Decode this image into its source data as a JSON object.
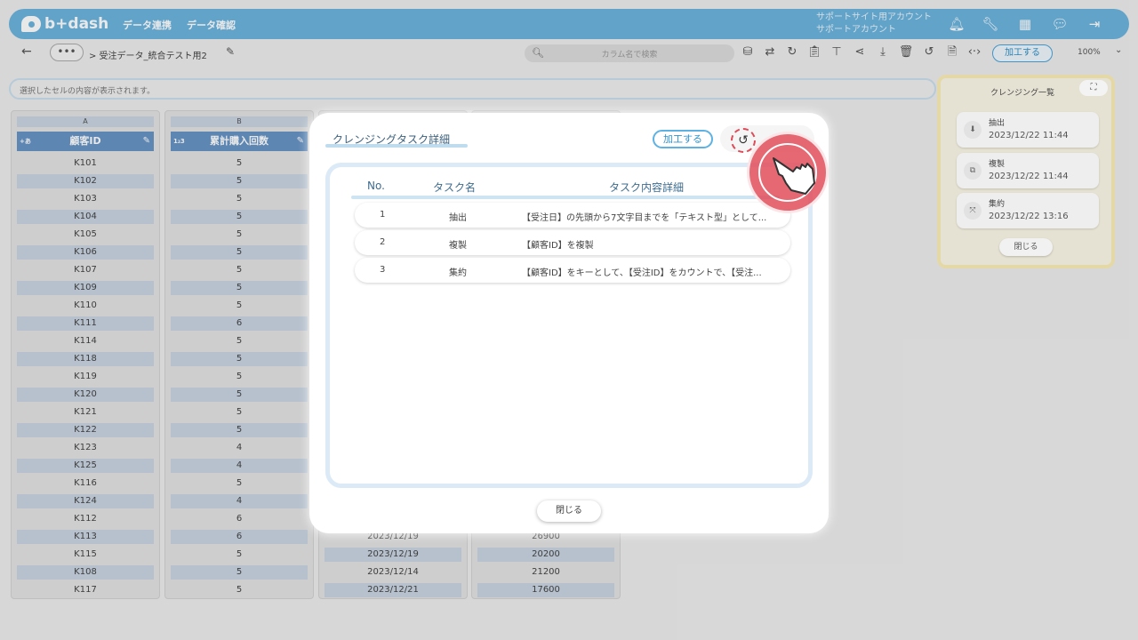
{
  "app": {
    "brand": "b+dash",
    "accent": "#6cb4de"
  },
  "nav": {
    "item1": "データ連携",
    "item2": "データ確認"
  },
  "account": {
    "line1": "サポートサイト用アカウント",
    "line2": "サポートアカウント"
  },
  "topbar_icons": [
    "bell-icon",
    "wrench-icon",
    "grid-icon",
    "chat-icon",
    "logout-icon"
  ],
  "breadcrumb": {
    "more": "•••",
    "path": "> 受注データ_統合テスト用2"
  },
  "search": {
    "placeholder": "カラム名で検索"
  },
  "toolbar": {
    "process_label": "加工する",
    "zoom": "100%"
  },
  "infobar": {
    "text": "選択したセルの内容が表示されます。"
  },
  "grid": {
    "col_a": {
      "letter": "A",
      "type": "+あ",
      "header": "顧客ID",
      "cells": [
        "K101",
        "K102",
        "K103",
        "K104",
        "K105",
        "K106",
        "K107",
        "K109",
        "K110",
        "K111",
        "K114",
        "K118",
        "K119",
        "K120",
        "K121",
        "K122",
        "K123",
        "K125",
        "K116",
        "K124",
        "K112",
        "K113",
        "K115",
        "K108",
        "K117"
      ]
    },
    "col_b": {
      "letter": "B",
      "type": "1₂3",
      "header": "累計購入回数",
      "cells": [
        "5",
        "5",
        "5",
        "5",
        "5",
        "5",
        "5",
        "5",
        "5",
        "6",
        "5",
        "5",
        "5",
        "5",
        "5",
        "5",
        "4",
        "4",
        "5",
        "4",
        "6",
        "6",
        "5",
        "5",
        "5"
      ]
    },
    "col_c": {
      "cells": [
        "2023/12/19",
        "2023/12/19",
        "2023/12/14",
        "2023/12/21"
      ]
    },
    "col_d": {
      "cells": [
        "26900",
        "20200",
        "21200",
        "17600"
      ]
    }
  },
  "side_panel": {
    "title": "クレンジング一覧",
    "items": [
      {
        "name": "抽出",
        "date": "2023/12/22 11:44"
      },
      {
        "name": "複製",
        "date": "2023/12/22 11:44"
      },
      {
        "name": "集約",
        "date": "2023/12/22 13:16"
      }
    ],
    "close_label": "閉じる"
  },
  "modal": {
    "title": "クレンジングタスク詳細",
    "process_label": "加工する",
    "columns": {
      "no": "No.",
      "name": "タスク名",
      "detail": "タスク内容詳細"
    },
    "rows": [
      {
        "no": "1",
        "name": "抽出",
        "detail": "【受注日】の先頭から7文字目までを「テキスト型」として..."
      },
      {
        "no": "2",
        "name": "複製",
        "detail": "【顧客ID】を複製"
      },
      {
        "no": "3",
        "name": "集約",
        "detail": "【顧客ID】をキーとして、【受注ID】をカウントで、【受注..."
      }
    ],
    "close_label": "閉じる"
  }
}
